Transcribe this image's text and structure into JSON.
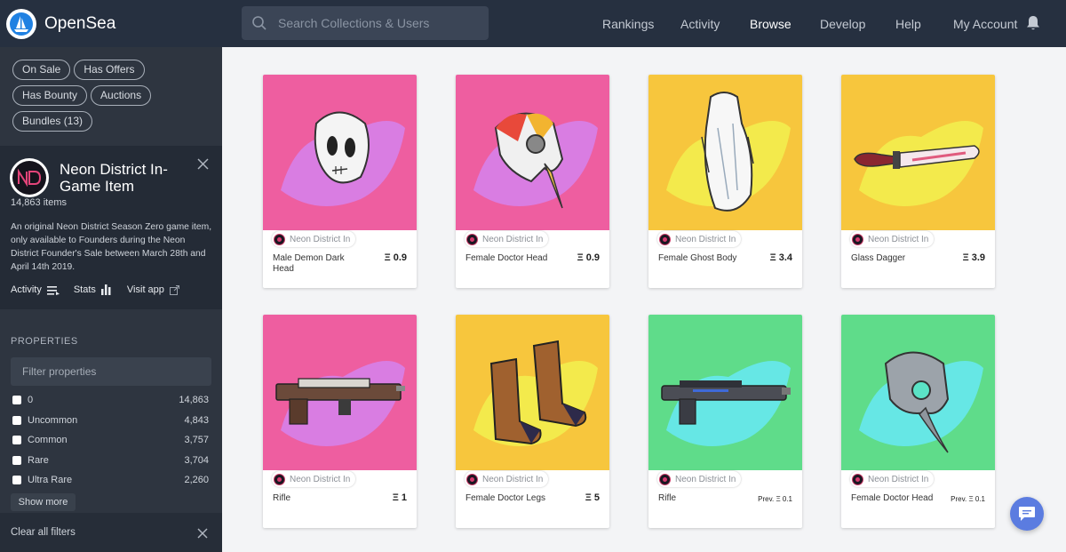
{
  "header": {
    "logo_text": "OpenSea",
    "search_placeholder": "Search Collections & Users",
    "nav": [
      "Rankings",
      "Activity",
      "Browse",
      "Develop",
      "Help",
      "My Account"
    ],
    "active_nav": "Browse"
  },
  "sidebar": {
    "chips": [
      "On Sale",
      "Has Offers",
      "Has Bounty",
      "Auctions",
      "Bundles (13)"
    ],
    "collection": {
      "title": "Neon District In-Game Item",
      "count": "14,863 items",
      "description": "An original Neon District Season Zero game item, only available to Founders during the Neon District Founder's Sale between March 28th and April 14th 2019.",
      "links": [
        "Activity",
        "Stats",
        "Visit app"
      ]
    },
    "properties_heading": "PROPERTIES",
    "filter_placeholder": "Filter properties",
    "properties": [
      {
        "name": "0",
        "count": "14,863"
      },
      {
        "name": "Uncommon",
        "count": "4,843"
      },
      {
        "name": "Common",
        "count": "3,757"
      },
      {
        "name": "Rare",
        "count": "3,704"
      },
      {
        "name": "Ultra Rare",
        "count": "2,260"
      }
    ],
    "show_more": "Show more",
    "clear_filters": "Clear all filters"
  },
  "cards": [
    {
      "collection": "Neon District In",
      "name": "Male Demon Dark Head",
      "price": "Ξ 0.9",
      "bg": "#ee5ea0",
      "splash": "#d77ee6",
      "item": "demon-head"
    },
    {
      "collection": "Neon District In",
      "name": "Female Doctor Head",
      "price": "Ξ 0.9",
      "bg": "#ee5ea0",
      "splash": "#d77ee6",
      "item": "doctor-head"
    },
    {
      "collection": "Neon District In",
      "name": "Female Ghost Body",
      "price": "Ξ 3.4",
      "bg": "#f7c63d",
      "splash": "#f2ec4d",
      "item": "ghost-body"
    },
    {
      "collection": "Neon District In",
      "name": "Glass Dagger",
      "price": "Ξ 3.9",
      "bg": "#f7c63d",
      "splash": "#f2ec4d",
      "item": "dagger"
    },
    {
      "collection": "Neon District In",
      "name": "Rifle",
      "price": "Ξ 1",
      "bg": "#ee5ea0",
      "splash": "#d77ee6",
      "item": "rifle"
    },
    {
      "collection": "Neon District In",
      "name": "Female Doctor Legs",
      "price": "Ξ 5",
      "bg": "#f7c63d",
      "splash": "#f2ec4d",
      "item": "boots"
    },
    {
      "collection": "Neon District In",
      "name": "Rifle",
      "price": "Prev. Ξ 0.1",
      "bg": "#5fdc8a",
      "splash": "#66e7ea",
      "item": "rifle2"
    },
    {
      "collection": "Neon District In",
      "name": "Female Doctor Head",
      "price": "Prev. Ξ 0.1",
      "bg": "#5fdc8a",
      "splash": "#66e7ea",
      "item": "plague-head"
    }
  ]
}
